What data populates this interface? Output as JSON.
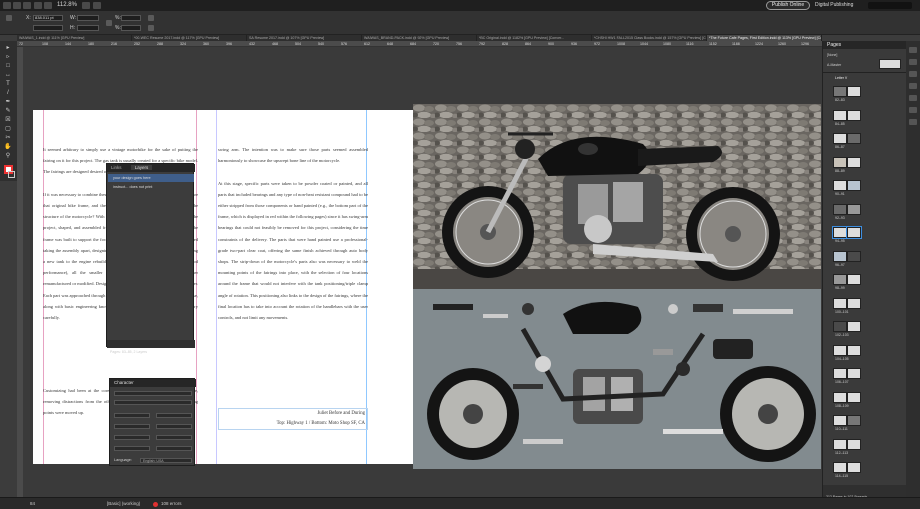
{
  "topbar": {
    "zoom": "112.8%",
    "publish_label": "Publish Online",
    "workspace": "Digital Publishing"
  },
  "control": {
    "x_value": "838.011 pt",
    "w_label": "W:",
    "h_label": "H:"
  },
  "tabs": [
    "WAIWAS_1.indd @ 111% [GPU Preview]",
    "*00-WEC Resume 2017.indd @ 117% [GPU Preview]",
    "SA Resume 2017.indd @ 107% [GPU Preview]",
    "WAIWAS_BRAND-PACK.indd @ 92% [GPU Preview]",
    "*BC Original.indd @ 1182% [GPU Preview] [Conver...",
    "*CHSHI HW1 FALL2015 Class Books.indd @ 157% [GPU Preview] [Conver...",
    "*The Future Cafe Pages, First Edition.indd @ 113% [GPU Preview] [Conv..."
  ],
  "ruler_ticks": [
    "72",
    "108",
    "144",
    "180",
    "216",
    "252",
    "288",
    "324",
    "360",
    "396",
    "432",
    "468",
    "504",
    "540",
    "576",
    "612",
    "648",
    "684",
    "720",
    "756",
    "792",
    "828",
    "864",
    "900",
    "936",
    "972",
    "1008",
    "1044",
    "1080",
    "1116",
    "1152",
    "1188",
    "1224",
    "1260",
    "1296"
  ],
  "document": {
    "left_col1": "It seemed arbitrary to simply use a vintage motorbike for the sake of putting the fairing on it for this project. The gas tank is usually created for a specific bike model. The fairings are designed desired outcome of a specific frame design.\n\nIf it was necessary to combine these parts, why not use a common user group to share that original bike frame, and then why not extend those parts to the rest of the structure of the motorcycle? With that in mind, the custom frame became part of the project, shaped, and assembled from 3D printed fairings and aluminum plates, the frame was built to support the focal elements. The whole process was also involved taking the assembly apart, designing, building and rebuilding it from scratch, adding a new tank to the engine rebuild (since the original design was set to give good performance), all the smaller structural parts were taken apart and either remanufactured or modified. Design choices for the new project had to work together. Each part was approached through the lens of aesthetics, function and common sense, along with basic engineering knowledge and a process of taking things apart very carefully.",
    "left_col2": "Customizing had been at the core of the aluminum longitudinal V-twin engine, removing distractions from the other components in the frame, engine mounting points were moved up.",
    "right_col": "swing arm. The intention was to make sure those parts seemed assembled harmoniously to showcase the upswept bone line of the motorcycle.\n\nAt this stage, specific parts were taken to be powder coated or painted, and all parts that included bearings and any type of non-heat resistant compound had to be either stripped from those components or hand painted (e.g., the bottom part of the frame, which is displayed in red within the following pages) since it has swing-arm bearings that could not feasibly be removed for this project, considering the time constraints of the delivery. The parts that were hand painted use a professional-grade two-part clear coat, offering the same finish achieved through auto body shops. The strip-down of the motorcycle's parts also was necessary to weld the mounting points of the fairings into place, with the selection of four locations around the frame that would not interfere with the tank positioning/triple clamp angle of rotation. This positioning also links to the design of the fairings, where the final location has to take into account the rotation of the handlebars with the user controls, and not limit any movements.",
    "caption_line1": "Juliet Before and During",
    "caption_line2": "Top: Highway 1 / Bottom:  Moto Shop SF, CA"
  },
  "layers_panel": {
    "tab_links": "Links",
    "tab_layers": "Layers",
    "rows": [
      "your design goes here",
      "instruct... does not print"
    ],
    "footer": "Pages: 83–85, 2 Layers"
  },
  "character_panel": {
    "title": "Character",
    "language_label": "Language:",
    "language_value": "English: USA"
  },
  "pages_panel": {
    "title": "Pages",
    "none_label": "[None]",
    "master_label": "A-Master",
    "section_label": "Letter V",
    "page_labels": [
      "82–83",
      "84–85",
      "86–87",
      "88–89",
      "90–91",
      "92–93",
      "94–95",
      "96–97",
      "98–99",
      "100–101",
      "102–103",
      "104–105",
      "106–107",
      "108–109",
      "110–111",
      "112–113",
      "114–115"
    ],
    "footer": "212 Pages in 107 Spreads"
  },
  "status": {
    "page": "84",
    "style": "[Basic] (working)",
    "errors": "108 errors"
  }
}
